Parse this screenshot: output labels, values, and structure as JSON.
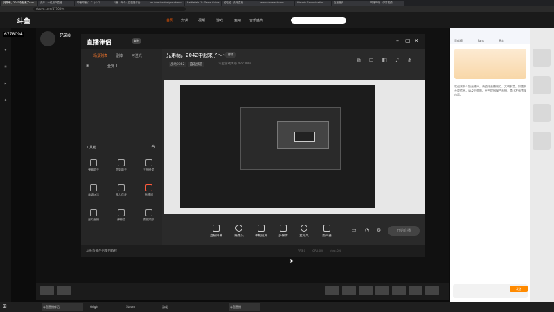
{
  "browser": {
    "tabs": [
      "兄弟萌，204Z中起来了～～",
      "虎牙 - 一亿用户直播",
      "哔哩哔哩 (゜-゜)つロ",
      "斗鱼 - 每个人的直播平台",
      "an interior design scheme",
      "Battlefield 1 · Game Guide",
      "哈哈哈 - 虎牙直播",
      "www.pinterest.com",
      "Historic Emancipation",
      "百度首页",
      "哔哩哔哩 - 弹幕视频"
    ],
    "url": "douyu.com/4770094"
  },
  "site": {
    "logo": "斗鱼",
    "nav": [
      "首页",
      "分类",
      "视频",
      "游戏",
      "鱼吧",
      "音乐盛典"
    ],
    "nav_active": 0
  },
  "stream": {
    "viewer_count": "6778094",
    "streamer_name": "兄弟8",
    "title": "兄弟萌，204Z中起来了～～"
  },
  "app": {
    "name": "直播伴侣",
    "version": "安装",
    "side_tabs": [
      "场景列表",
      "副本",
      "可选光"
    ],
    "scene_name": "全屏 1",
    "toolbox_label": "工具箱",
    "tools": [
      {
        "label": "弹幕助手"
      },
      {
        "label": "房管助手"
      },
      {
        "label": "主播任务"
      },
      {
        "label": "高级玩法"
      },
      {
        "label": "多人连麦"
      },
      {
        "label": "直播间"
      },
      {
        "label": "虚拟直播"
      },
      {
        "label": "弹幕墙"
      },
      {
        "label": "数据助手"
      }
    ],
    "stream_title": "兄弟萌，204Z中起来了～～",
    "modify_label": "修改",
    "game_category": "战地2042",
    "tag_label": "自选频道",
    "room_name": "斗鱼游戏大哥 4770094",
    "controls": [
      "直播屏幕",
      "摄像头",
      "手机投屏",
      "多媒体",
      "麦克风",
      "扬声器"
    ],
    "start_live": "开始直播",
    "status_text": "斗鱼直播伴侣使用教程",
    "stats": [
      "FPS:0",
      "CPU:0%",
      "内存:0%"
    ]
  },
  "chat": {
    "tabs": [
      "贡献榜",
      "Fans",
      "贵宾"
    ],
    "message": "欢迎来到斗鱼直播间，请遵守直播规范，文明发言。如遇到不良信息，请及时举报。平台提倡绿色直播，禁止发布违规内容。",
    "send_label": "发送"
  },
  "taskbar": {
    "items": [
      "斗鱼直播伴侣",
      "Origin",
      "Steam",
      "游戏",
      "斗鱼直播"
    ]
  }
}
